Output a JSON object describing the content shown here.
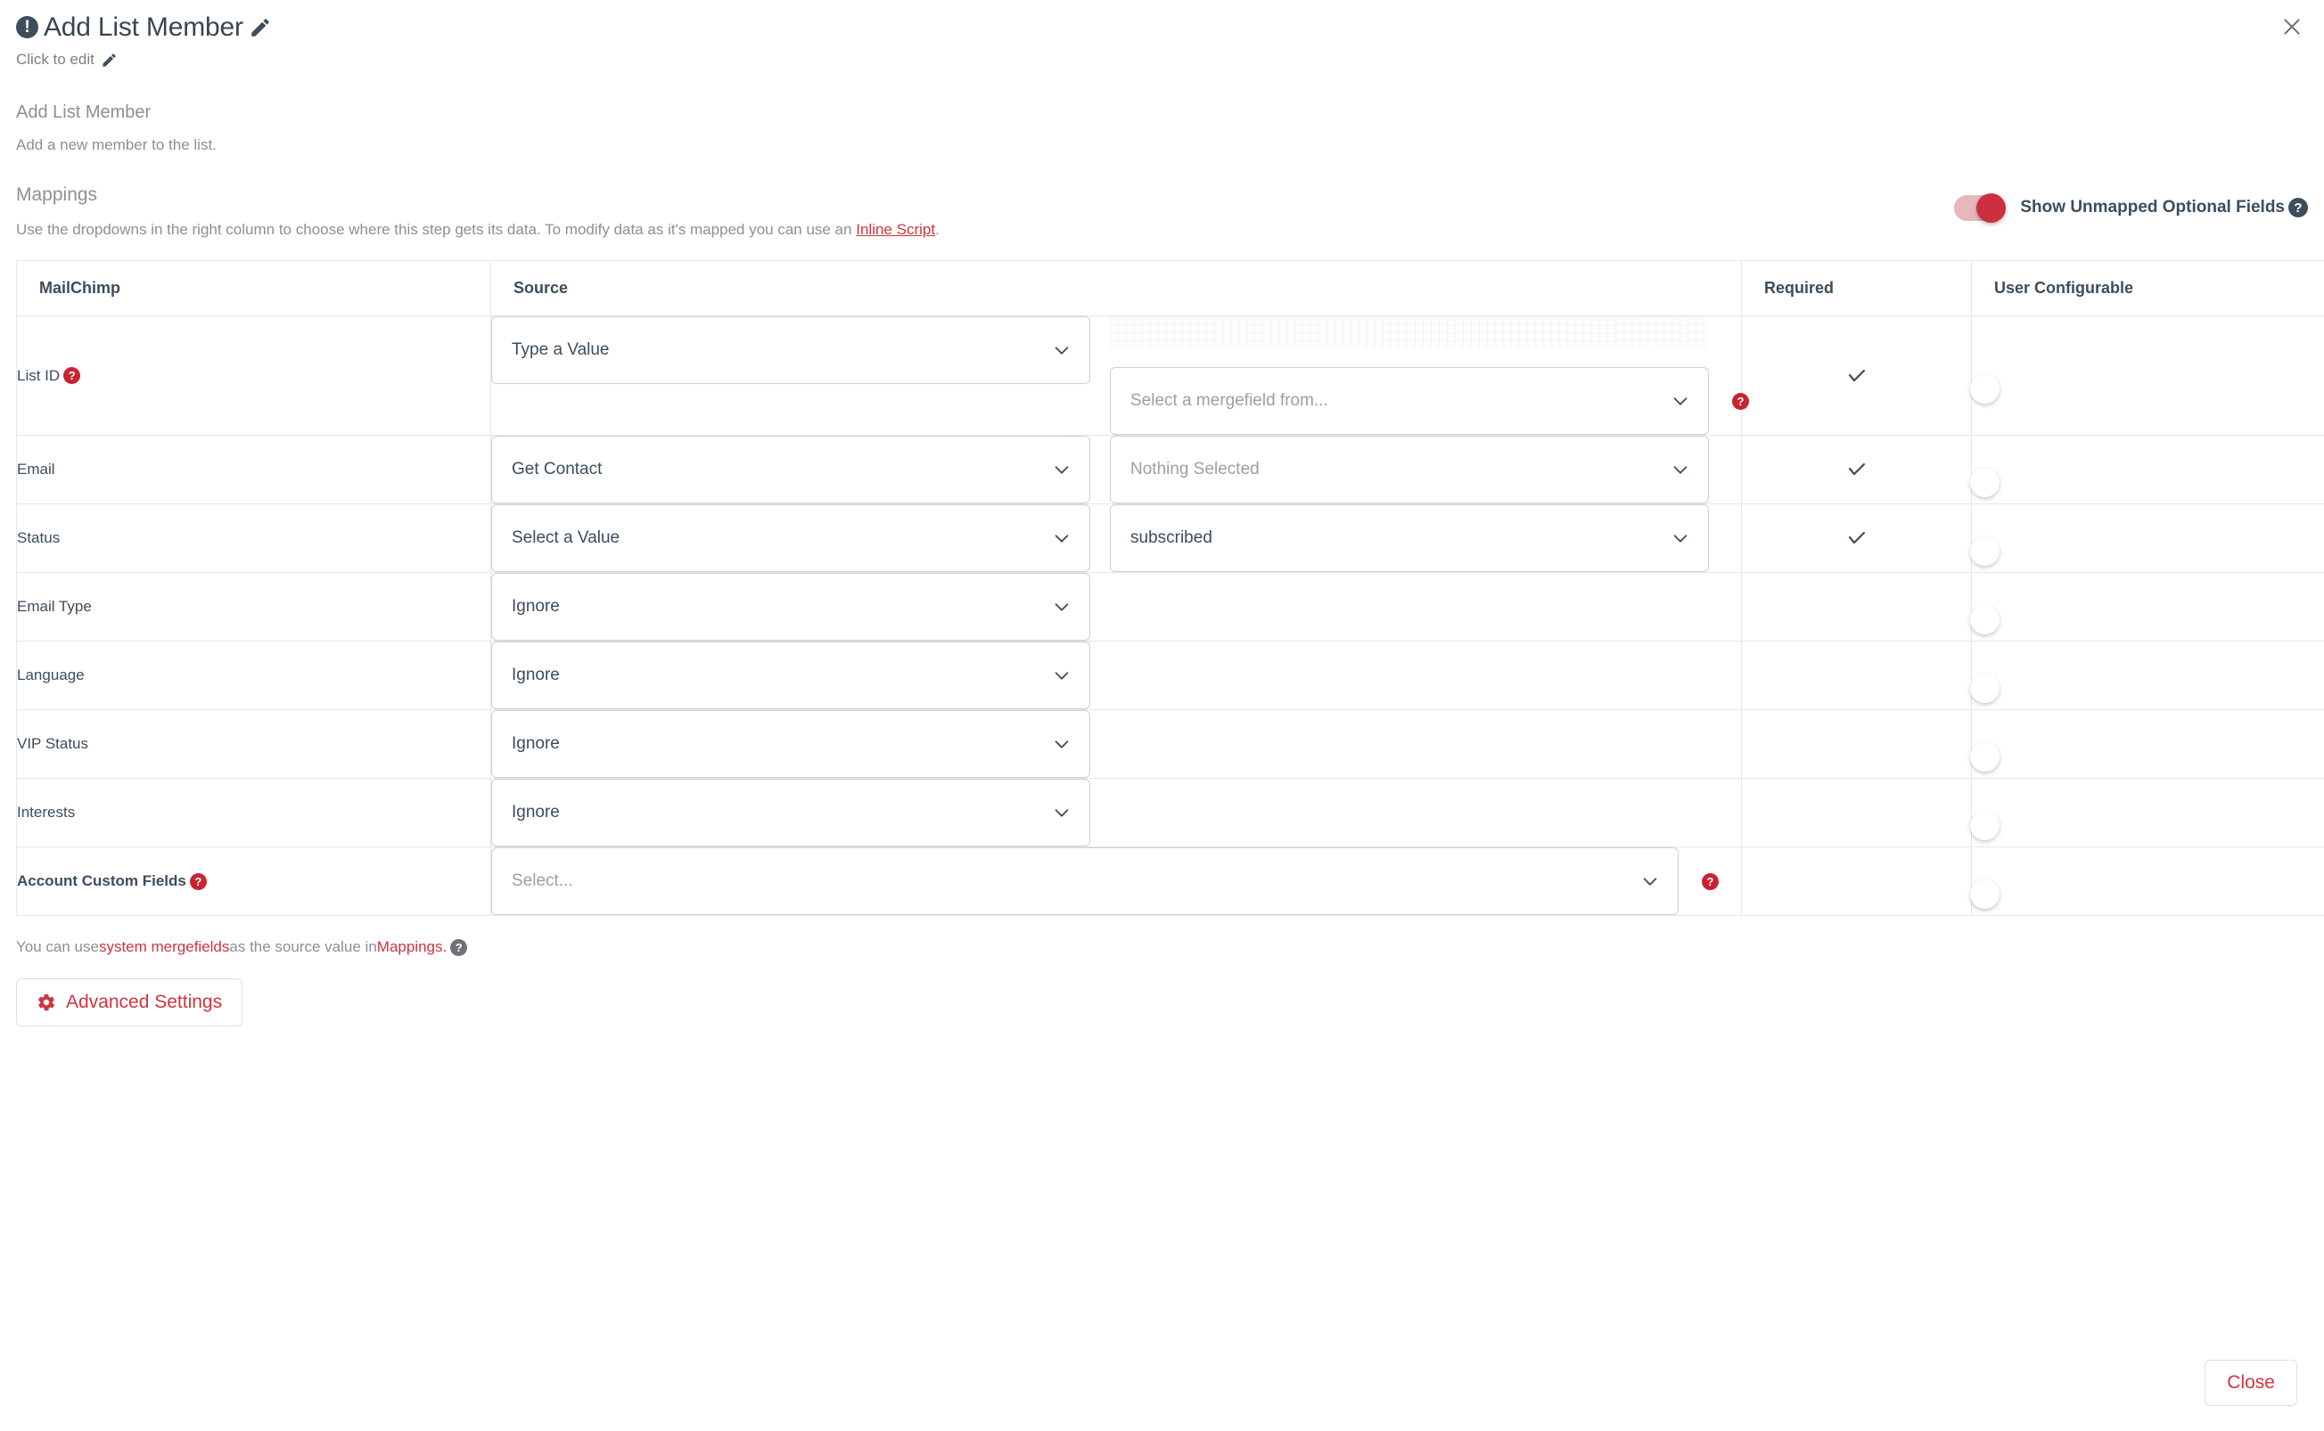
{
  "header": {
    "alert_icon": "exclamation-circle-icon",
    "title": "Add List Member",
    "title_edit_icon": "pencil-icon",
    "subtitle": "Click to edit",
    "subtitle_edit_icon": "pencil-icon",
    "close_icon": "close-icon",
    "step_name": "Add List Member",
    "step_description": "Add a new member to the list."
  },
  "mappings": {
    "title": "Mappings",
    "description_pre": "Use the dropdowns in the right column to choose where this step gets its data. To modify data as it's mapped you can use an ",
    "description_link": "Inline Script",
    "description_post": ".",
    "show_unmapped_label": "Show Unmapped Optional Fields",
    "show_unmapped_on": true,
    "show_unmapped_help_icon": "question-mark-icon",
    "columns": {
      "field": "MailChimp",
      "source": "Source",
      "required": "Required",
      "user_configurable": "User Configurable"
    },
    "rows": [
      {
        "field": "List ID",
        "field_bold": false,
        "field_help_icon": "question-mark-icon-red",
        "source_type": "Type a Value",
        "second_kind": "hatched-stack",
        "second_value": "Select a mergefield from...",
        "second_is_placeholder": true,
        "second_help_icon": "question-mark-icon-red",
        "required": true,
        "user_configurable": false
      },
      {
        "field": "Email",
        "field_bold": false,
        "source_type": "Get Contact",
        "second_kind": "select",
        "second_value": "Nothing Selected",
        "second_is_placeholder": true,
        "required": true,
        "user_configurable": false
      },
      {
        "field": "Status",
        "field_bold": false,
        "source_type": "Select a Value",
        "second_kind": "select",
        "second_value": "subscribed",
        "second_is_placeholder": false,
        "required": true,
        "user_configurable": false
      },
      {
        "field": "Email Type",
        "field_bold": false,
        "source_type": "Ignore",
        "second_kind": "none",
        "required": false,
        "user_configurable": false
      },
      {
        "field": "Language",
        "field_bold": false,
        "source_type": "Ignore",
        "second_kind": "none",
        "required": false,
        "user_configurable": false
      },
      {
        "field": "VIP Status",
        "field_bold": false,
        "source_type": "Ignore",
        "second_kind": "none",
        "required": false,
        "user_configurable": false
      },
      {
        "field": "Interests",
        "field_bold": false,
        "source_type": "Ignore",
        "second_kind": "none",
        "required": false,
        "user_configurable": false
      },
      {
        "field": "Account Custom Fields",
        "field_bold": true,
        "field_help_icon": "question-mark-icon-red",
        "source_type": "Select...",
        "source_wide": true,
        "source_is_placeholder": true,
        "source_help_icon": "question-mark-icon-red",
        "second_kind": "none",
        "required": false,
        "user_configurable": false
      }
    ]
  },
  "footer": {
    "note_pre": "You can use ",
    "note_link1": "system mergefields",
    "note_mid": " as the source value in ",
    "note_link2": "Mappings.",
    "note_help_icon": "question-mark-icon-gray",
    "advanced_settings_label": "Advanced Settings",
    "advanced_settings_icon": "gear-icon",
    "close_label": "Close"
  },
  "colors": {
    "accent_red": "#d0343f",
    "toggle_on": "#cc2f3e",
    "text_dark": "#3c4d5d",
    "text_muted": "#8a9097",
    "border": "#e4e6e8"
  }
}
